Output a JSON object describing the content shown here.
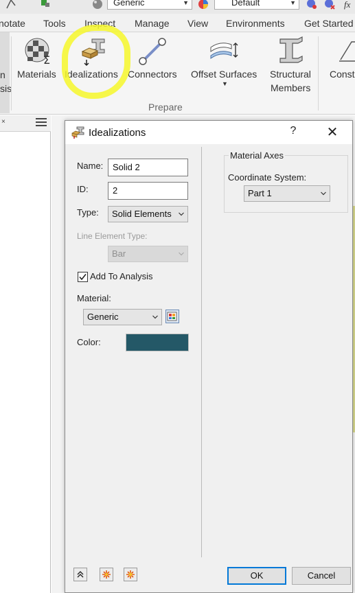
{
  "topbar": {
    "material_value": "Generic",
    "appearance_value": "Default"
  },
  "tabs": [
    "notate",
    "Tools",
    "Inspect",
    "Manage",
    "View",
    "Environments",
    "Get Started"
  ],
  "ribbon": {
    "left_cut_label_1": "n",
    "left_cut_label_2": "sis",
    "buttons": {
      "materials": "Materials",
      "idealizations": "Idealizations",
      "connectors": "Connectors",
      "offset_surfaces": "Offset Surfaces",
      "structural_members_1": "Structural",
      "structural_members_2": "Members",
      "constraints_cut": "Const"
    },
    "group_label": "Prepare",
    "highlight_color": "#f6f72a"
  },
  "dialog": {
    "title": "Idealizations",
    "help_label": "?",
    "close_label": "✕",
    "name_label": "Name:",
    "name_value": "Solid 2",
    "id_label": "ID:",
    "id_value": "2",
    "type_label": "Type:",
    "type_value": "Solid Elements",
    "line_element_type_label": "Line Element Type:",
    "line_element_type_value": "Bar",
    "add_to_analysis_label": "Add To Analysis",
    "add_to_analysis_checked": true,
    "material_label": "Material:",
    "material_value": "Generic",
    "color_label": "Color:",
    "color_value": "#245867",
    "material_axes_title": "Material Axes",
    "coordinate_system_label": "Coordinate System:",
    "coordinate_system_value": "Part 1",
    "ok_label": "OK",
    "cancel_label": "Cancel"
  },
  "icons": {
    "collapse": "chevron-up-double-icon",
    "star_1": "asterisk-icon",
    "star_2": "asterisk-icon"
  }
}
